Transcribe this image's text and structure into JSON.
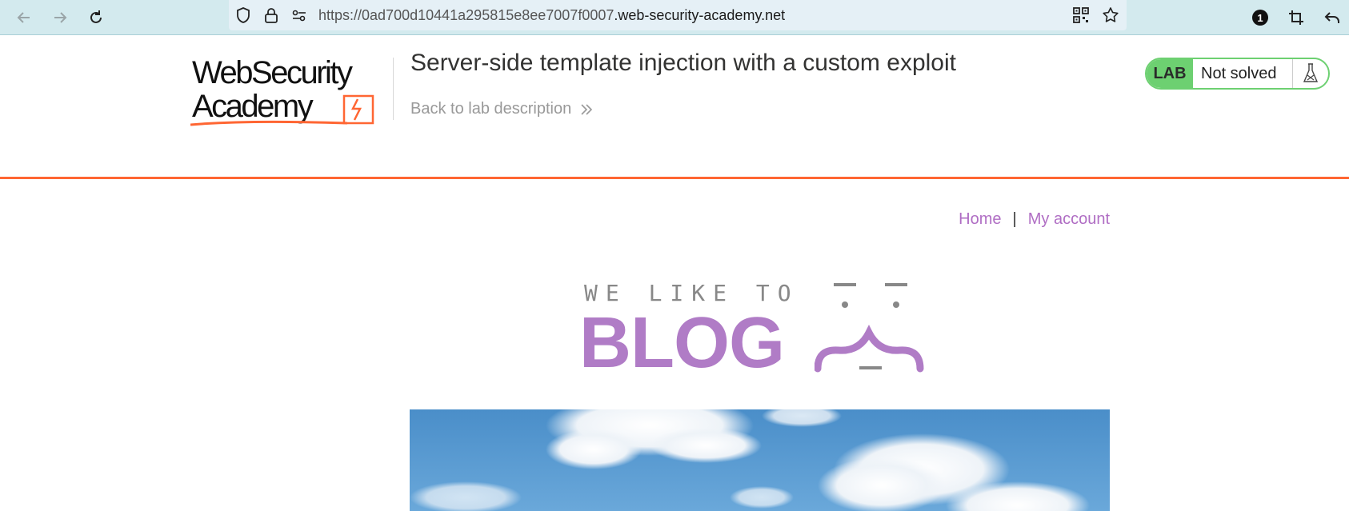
{
  "browser": {
    "url_prefix": "https://0ad700d10441a295815e8ee7007f0007",
    "url_host": ".web-security-academy.net",
    "extension_badge": "1"
  },
  "lab": {
    "logo_line1": "WebSecurity",
    "logo_line2": "Academy",
    "title": "Server-side template injection with a custom exploit",
    "back_link": "Back to lab description",
    "badge": "LAB",
    "status": "Not solved",
    "accent_color": "#ff6633",
    "status_color": "#6dd071"
  },
  "nav": {
    "home": "Home",
    "separator": "|",
    "my_account": "My account",
    "link_color": "#b06ec4"
  },
  "banner": {
    "tagline": "WE LIKE TO",
    "word": "BLOG"
  }
}
